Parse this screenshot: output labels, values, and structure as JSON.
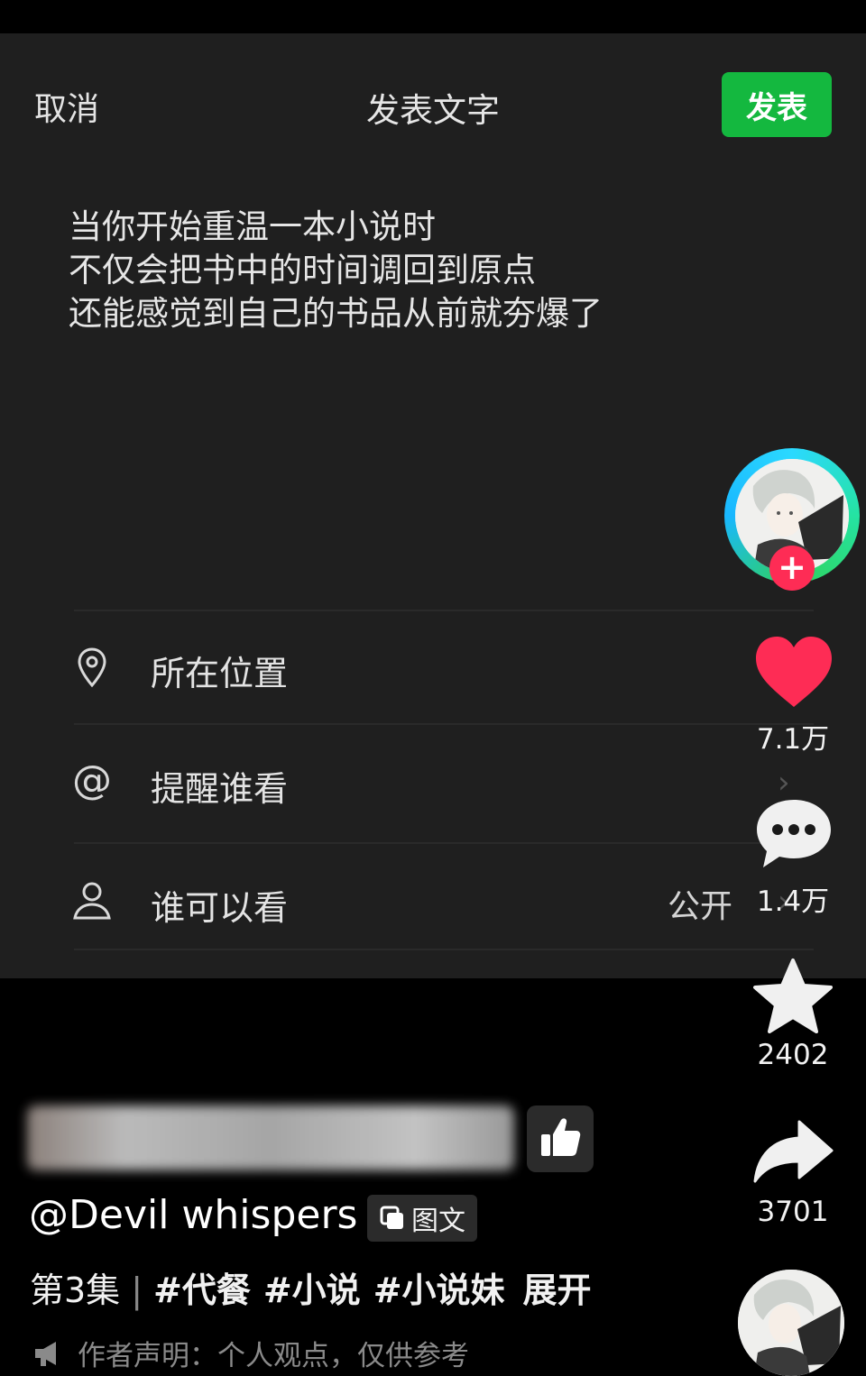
{
  "header": {
    "cancel_label": "取消",
    "title": "发表文字",
    "publish_label": "发表"
  },
  "post": {
    "lines": [
      "当你开始重温一本小说时",
      "不仅会把书中的时间调回到原点",
      "还能感觉到自己的书品从前就夯爆了"
    ]
  },
  "options": {
    "location_label": "所在位置",
    "mention_label": "提醒谁看",
    "visibility_label": "谁可以看",
    "visibility_value": "公开"
  },
  "rail": {
    "likes": "7.1万",
    "comments": "1.4万",
    "favorites": "2402",
    "shares": "3701",
    "follow_symbol": "+"
  },
  "info": {
    "author": "@Devil whispers",
    "type_badge": "图文",
    "episode": "第3集",
    "tags": [
      "#代餐",
      "#小说",
      "#小说妹"
    ],
    "expand_label": "展开",
    "statement": "作者声明：个人观点，仅供参考"
  },
  "colors": {
    "accent_green": "#14b83f",
    "like_red": "#fe2c55",
    "panel_bg": "#1f1f1f"
  }
}
